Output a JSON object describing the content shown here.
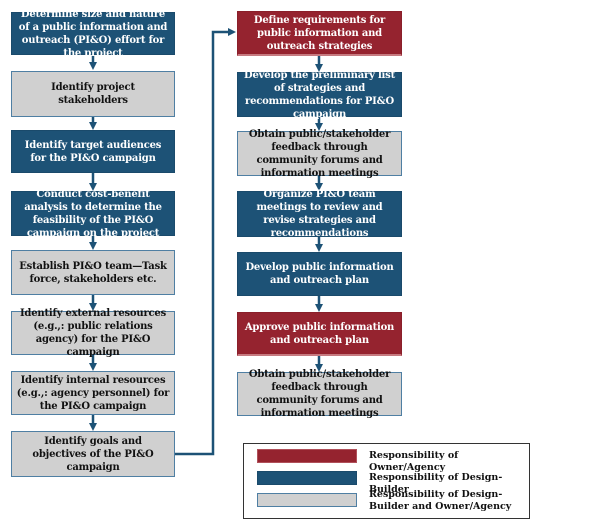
{
  "colors": {
    "owner_agency": "#95232f",
    "design_builder": "#1d5276",
    "shared": "#d0d0d0",
    "connector": "#1d5276"
  },
  "left_column": [
    {
      "text": "Determine size and nature of a public information and outreach (PI&O) effort for the project",
      "responsibility": "design_builder"
    },
    {
      "text": "Identify project stakeholders",
      "responsibility": "shared"
    },
    {
      "text": "Identify  target audiences for the PI&O campaign",
      "responsibility": "design_builder"
    },
    {
      "text": "Conduct cost-benefit analysis to determine the feasibility of the PI&O campaign on the project",
      "responsibility": "design_builder"
    },
    {
      "text": "Establish PI&O team—Task force, stakeholders etc.",
      "responsibility": "shared"
    },
    {
      "text": "Identify external resources (e.g.,: public relations agency) for the PI&O campaign",
      "responsibility": "shared"
    },
    {
      "text": "Identify internal resources (e.g.,: agency personnel) for the PI&O campaign",
      "responsibility": "shared"
    },
    {
      "text": "Identify goals and objectives of the PI&O campaign",
      "responsibility": "shared"
    }
  ],
  "right_column": [
    {
      "text": "Define requirements for public information and outreach strategies",
      "responsibility": "owner_agency"
    },
    {
      "text": "Develop the preliminary list of strategies and recommendations for PI&O campaign",
      "responsibility": "design_builder"
    },
    {
      "text": "Obtain public/stakeholder feedback through community forums and information meetings",
      "responsibility": "shared"
    },
    {
      "text": "Organize PI&O team meetings to review and revise strategies and recommendations",
      "responsibility": "design_builder"
    },
    {
      "text": "Develop public information and outreach plan",
      "responsibility": "design_builder"
    },
    {
      "text": "Approve public information and outreach plan",
      "responsibility": "owner_agency"
    },
    {
      "text": "Obtain public/stakeholder feedback through community forums and information meetings",
      "responsibility": "shared"
    }
  ],
  "legend": [
    {
      "label": "Responsibility of Owner/Agency",
      "responsibility": "owner_agency"
    },
    {
      "label": "Responsibility of Design-Builder",
      "responsibility": "design_builder"
    },
    {
      "label": "Responsibility of Design-Builder and Owner/Agency",
      "responsibility": "shared"
    }
  ]
}
